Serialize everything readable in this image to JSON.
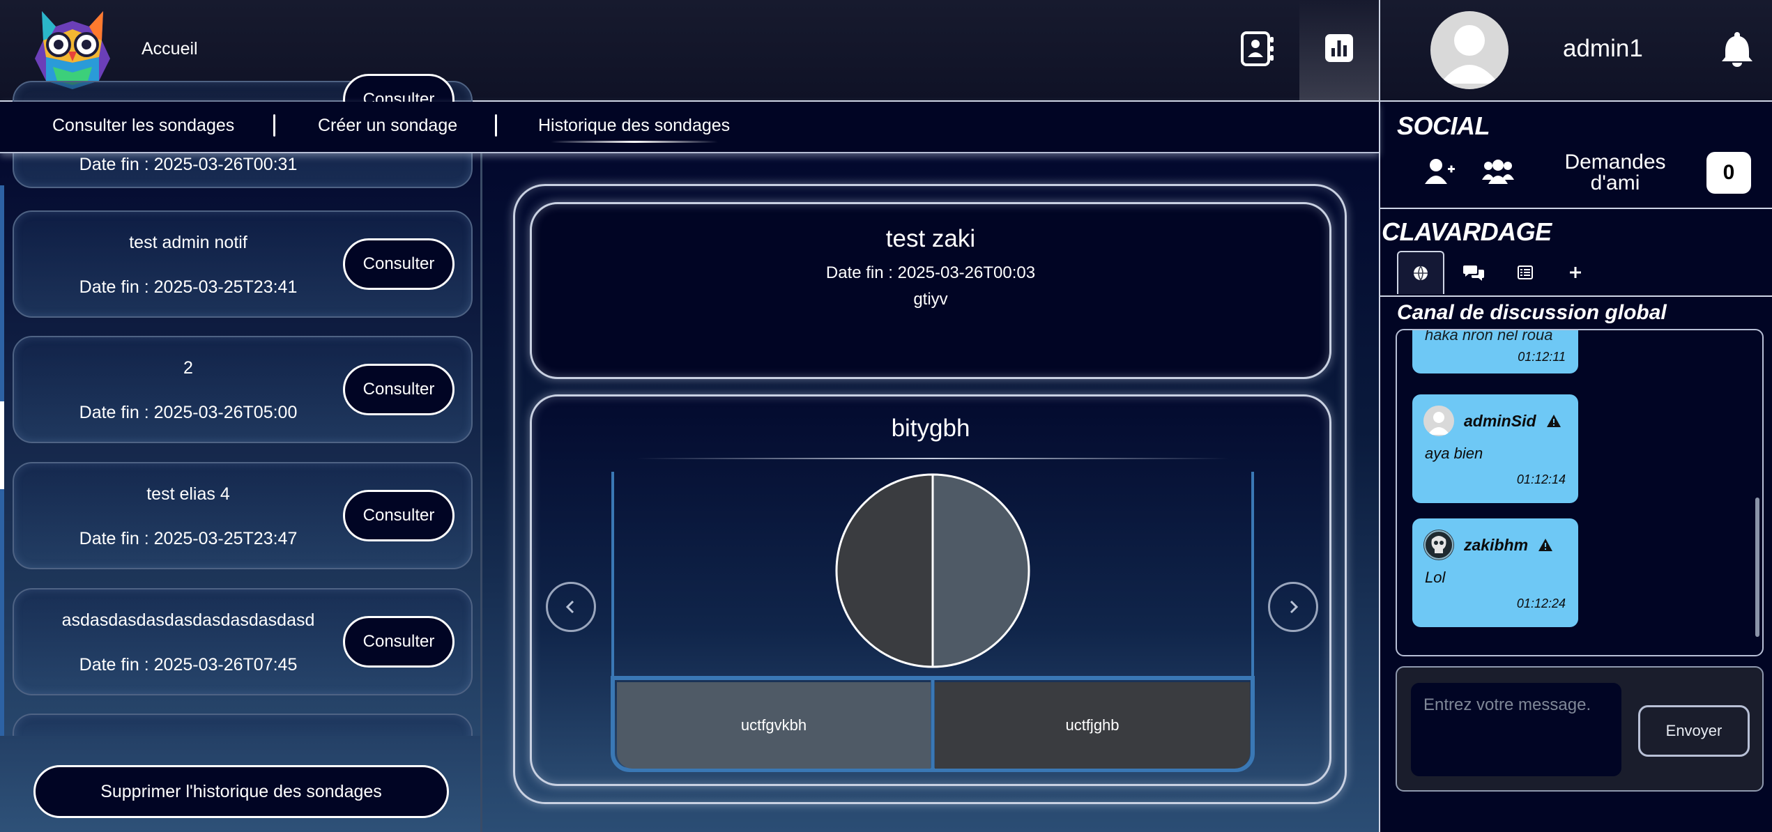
{
  "header": {
    "home_label": "Accueil",
    "username": "admin1",
    "icons": [
      "owl-logo",
      "contacts-book-icon",
      "bar-chart-icon",
      "avatar",
      "bell-icon"
    ]
  },
  "subnav": {
    "items": [
      {
        "label": "Consulter les sondages"
      },
      {
        "label": "Créer un sondage"
      },
      {
        "label": "Historique des sondages",
        "active": true
      }
    ]
  },
  "history": {
    "consult_label": "Consulter",
    "partial_top_date": "Date fin : 2025-03-26T00:31",
    "surveys": [
      {
        "title": "test admin notif",
        "date": "Date fin : 2025-03-25T23:41"
      },
      {
        "title": "2",
        "date": "Date fin : 2025-03-26T05:00"
      },
      {
        "title": "test elias 4",
        "date": "Date fin : 2025-03-25T23:47"
      },
      {
        "title": "asdasdasdasdasdasdasdasdasd",
        "date": "Date fin : 2025-03-26T07:45"
      }
    ],
    "delete_label": "Supprimer l'historique des sondages"
  },
  "survey_detail": {
    "title": "test zaki",
    "date": "Date fin : 2025-03-26T00:03",
    "description": "gtiyv",
    "question": "bitygbh"
  },
  "chart_data": {
    "type": "pie",
    "title": "bitygbh",
    "categories": [
      "uctfgvkbh",
      "uctfjghb"
    ],
    "values": [
      50,
      50
    ],
    "colors": [
      "#4f5a66",
      "#3a3c40"
    ],
    "legend": "bottom"
  },
  "social": {
    "title": "SOCIAL",
    "friend_requests_label": "Demandes d'ami",
    "friend_requests_count": "0",
    "icons": [
      "add-friend-icon",
      "friends-group-icon"
    ]
  },
  "chat": {
    "title": "CLAVARDAGE",
    "tabs": [
      "globe-icon",
      "chat-bubbles-icon",
      "list-icon",
      "plus-icon"
    ],
    "channel_name": "Canal de discussion global",
    "messages": [
      {
        "author": "",
        "text": "haka nron nel roua",
        "time": "01:12:11"
      },
      {
        "author": "adminSid",
        "text": "aya bien",
        "time": "01:12:14"
      },
      {
        "author": "zakibhm",
        "text": "Lol",
        "time": "01:12:24"
      }
    ],
    "input_placeholder": "Entrez votre message.",
    "send_label": "Envoyer"
  },
  "colors": {
    "background": "#010524",
    "chat_bubble": "#6ec8f5",
    "accent_border": "#3a78b5"
  }
}
